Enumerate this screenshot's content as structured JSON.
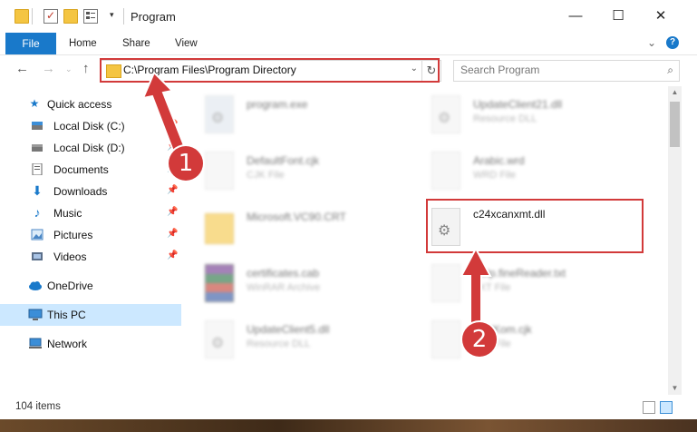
{
  "window": {
    "title": "Program",
    "controls": {
      "minimize": "—",
      "maximize": "☐",
      "close": "✕"
    }
  },
  "ribbon": {
    "tabs": [
      "File",
      "Home",
      "Share",
      "View"
    ],
    "expand_icon": "chevron-down-icon",
    "help": "?"
  },
  "address": {
    "path": "C:\\Program Files\\Program Directory",
    "search_placeholder": "Search Program"
  },
  "sidebar": {
    "items": [
      {
        "label": "Quick access",
        "icon": "star-icon",
        "pinned": false
      },
      {
        "label": "Local Disk (C:)",
        "icon": "drive-icon",
        "pinned": true
      },
      {
        "label": "Local Disk (D:)",
        "icon": "drive-icon",
        "pinned": true
      },
      {
        "label": "Documents",
        "icon": "document-icon",
        "pinned": true
      },
      {
        "label": "Downloads",
        "icon": "download-icon",
        "pinned": true
      },
      {
        "label": "Music",
        "icon": "music-icon",
        "pinned": true
      },
      {
        "label": "Pictures",
        "icon": "picture-icon",
        "pinned": true
      },
      {
        "label": "Videos",
        "icon": "video-icon",
        "pinned": true
      },
      {
        "label": "OneDrive",
        "icon": "cloud-icon",
        "pinned": false
      },
      {
        "label": "This PC",
        "icon": "computer-icon",
        "pinned": false,
        "selected": true
      },
      {
        "label": "Network",
        "icon": "network-icon",
        "pinned": false
      }
    ]
  },
  "files": [
    {
      "name": "program.exe",
      "type": "",
      "icon": "exe-icon",
      "blurred": true
    },
    {
      "name": "UpdateClient21.dll",
      "type": "Resource DLL",
      "icon": "dll-icon",
      "blurred": true
    },
    {
      "name": "DefaultFont.cjk",
      "type": "CJK File",
      "icon": "file-icon",
      "blurred": true
    },
    {
      "name": "Arabic.wrd",
      "type": "WRD File",
      "icon": "file-icon",
      "blurred": true
    },
    {
      "name": "Microsoft.VC90.CRT",
      "type": "",
      "icon": "folder-icon",
      "blurred": true
    },
    {
      "name": "c24xcanxmt.dll",
      "type": "",
      "icon": "dll-icon",
      "blurred": false,
      "highlighted": true
    },
    {
      "name": "certificates.cab",
      "type": "WinRAR Archive",
      "icon": "rar-icon",
      "blurred": true
    },
    {
      "name": "Help.fineReader.txt",
      "type": "TXT File",
      "icon": "file-icon",
      "blurred": true
    },
    {
      "name": "UpdateClient5.dll",
      "type": "Resource DLL",
      "icon": "dll-icon",
      "blurred": true
    },
    {
      "name": "TestKom.cjk",
      "type": "CJK File",
      "icon": "file-icon",
      "blurred": true
    }
  ],
  "status": {
    "item_count": "104 items"
  },
  "annotations": {
    "step1": "1",
    "step2": "2",
    "color": "#d23a3a"
  }
}
